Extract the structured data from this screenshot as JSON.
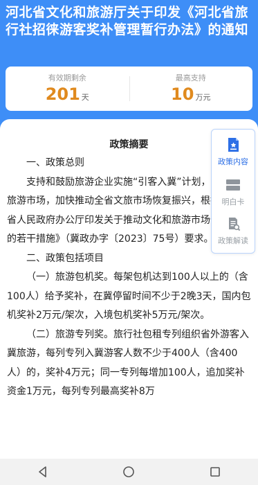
{
  "header": {
    "title": "河北省文化和旅游厅关于印发《河北省旅行社招徕游客奖补管理暂行办法》的通知"
  },
  "stats": {
    "validity": {
      "label": "有效期剩余",
      "value": "201",
      "unit": "天"
    },
    "max_support": {
      "label": "最高支持",
      "value": "10",
      "unit": "万元"
    }
  },
  "content": {
    "summary_title": "政策摘要",
    "paragraphs": [
      "一、政策总则",
      "支持和鼓励旅游企业实施“引客入冀”计划，激活地接旅游市场，加快推动全省文旅市场恢复振兴，根据《河北省人民政府办公厅印发关于推动文化和旅游市场恢复振兴的若干措施》（冀政办字〔2023〕75号）要求。",
      "二、政策包括项目",
      "（一）旅游包机奖。每架包机达到100人以上的（含100人）给予奖补，在冀停留时间不少于2晚3天，国内包机奖补2万元/架次，入境包机奖补5万元/架次。",
      "（二）旅游专列奖。旅行社包租专列组织省外游客入冀旅游，每列专列入冀游客人数不少于400人（含400人）的，奖补4万元；同一专列每增加100人，追加奖补资金1万元，每列专列最高奖补8万"
    ]
  },
  "side_panel": {
    "items": [
      {
        "label": "政策内容",
        "icon": "policy-document-icon",
        "active": true
      },
      {
        "label": "明白卡",
        "icon": "card-icon",
        "active": false
      },
      {
        "label": "政策解读",
        "icon": "interpretation-icon",
        "active": false
      }
    ]
  },
  "nav": {
    "back": "back-triangle-icon",
    "home": "home-circle-icon",
    "recent": "recent-square-icon"
  },
  "colors": {
    "header_bg": "#3e8ef7",
    "accent_number": "#e08a1e",
    "active_tab": "#2d6fe6"
  }
}
